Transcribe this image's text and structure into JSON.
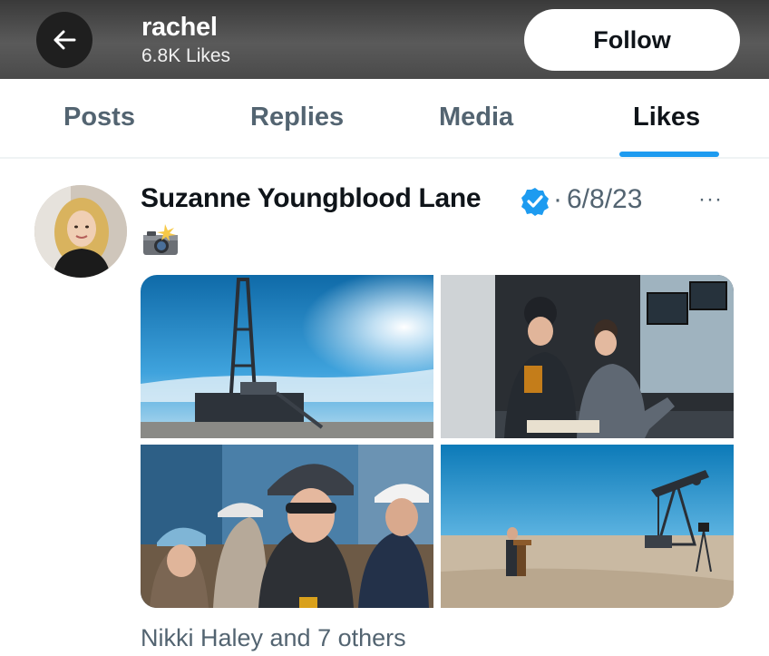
{
  "header": {
    "title": "rachel",
    "subtitle": "6.8K Likes",
    "follow_label": "Follow"
  },
  "tabs": [
    {
      "label": "Posts",
      "active": false
    },
    {
      "label": "Replies",
      "active": false
    },
    {
      "label": "Media",
      "active": false
    },
    {
      "label": "Likes",
      "active": true
    }
  ],
  "post": {
    "author": "Suzanne Youngblood Lane",
    "verified": true,
    "separator": "·",
    "date": "6/8/23",
    "more_label": "···",
    "emoji": "camera-with-flash",
    "photos": [
      {
        "icon": "drilling-rig-photo"
      },
      {
        "icon": "control-room-photo"
      },
      {
        "icon": "hard-hat-group-photo"
      },
      {
        "icon": "pumpjack-podium-photo"
      }
    ],
    "liked_by": "Nikki Haley and 7 others"
  },
  "colors": {
    "accent": "#1d9bf0",
    "text_primary": "#0f1419",
    "text_secondary": "#536471",
    "header_bg": "#4a4a4a"
  }
}
